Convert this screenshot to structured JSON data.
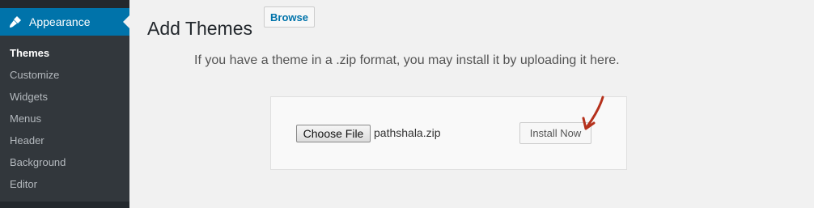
{
  "sidebar": {
    "active_menu": {
      "label": "Appearance",
      "icon": "paintbrush-icon"
    },
    "items": [
      {
        "label": "Themes",
        "current": true
      },
      {
        "label": "Customize"
      },
      {
        "label": "Widgets"
      },
      {
        "label": "Menus"
      },
      {
        "label": "Header"
      },
      {
        "label": "Background"
      },
      {
        "label": "Editor"
      }
    ]
  },
  "main": {
    "title": "Add Themes",
    "browse_label": "Browse",
    "help_text": "If you have a theme in a .zip format, you may install it by uploading it here.",
    "upload": {
      "choose_file_label": "Choose File",
      "file_name": "pathshala.zip",
      "install_label": "Install Now"
    }
  },
  "colors": {
    "accent": "#0073aa",
    "sidebar_bg": "#23282d",
    "submenu_bg": "#32373c",
    "annotation_arrow": "#b5311c"
  }
}
